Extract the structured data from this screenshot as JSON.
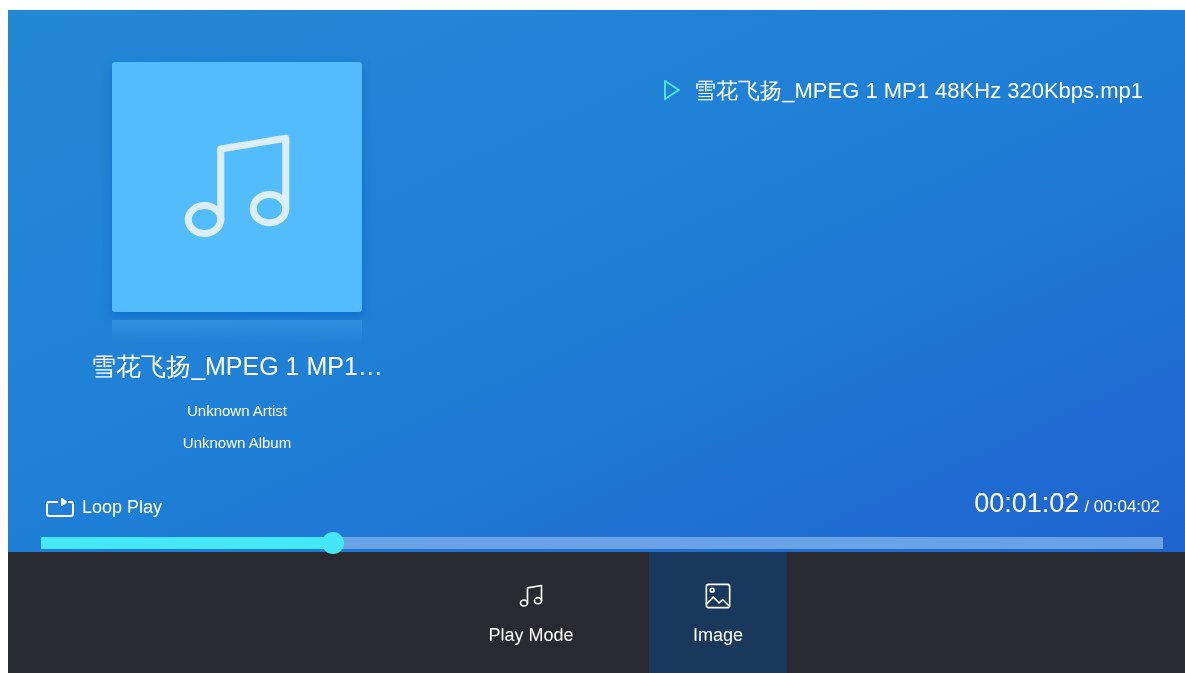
{
  "now_playing": {
    "file": "雪花飞扬_MPEG 1 MP1 48KHz 320Kbps.mp1"
  },
  "track": {
    "title": "雪花飞扬_MPEG 1 MP1…",
    "artist": "Unknown Artist",
    "album": "Unknown Album"
  },
  "play_mode": {
    "label": "Loop Play"
  },
  "time": {
    "elapsed": "00:01:02",
    "total": "/ 00:04:02"
  },
  "progress": {
    "level": 0.26
  },
  "menu": [
    {
      "kind": "music",
      "label": "Play Mode",
      "selected": false
    },
    {
      "kind": "image",
      "label": "Image",
      "selected": true
    }
  ]
}
